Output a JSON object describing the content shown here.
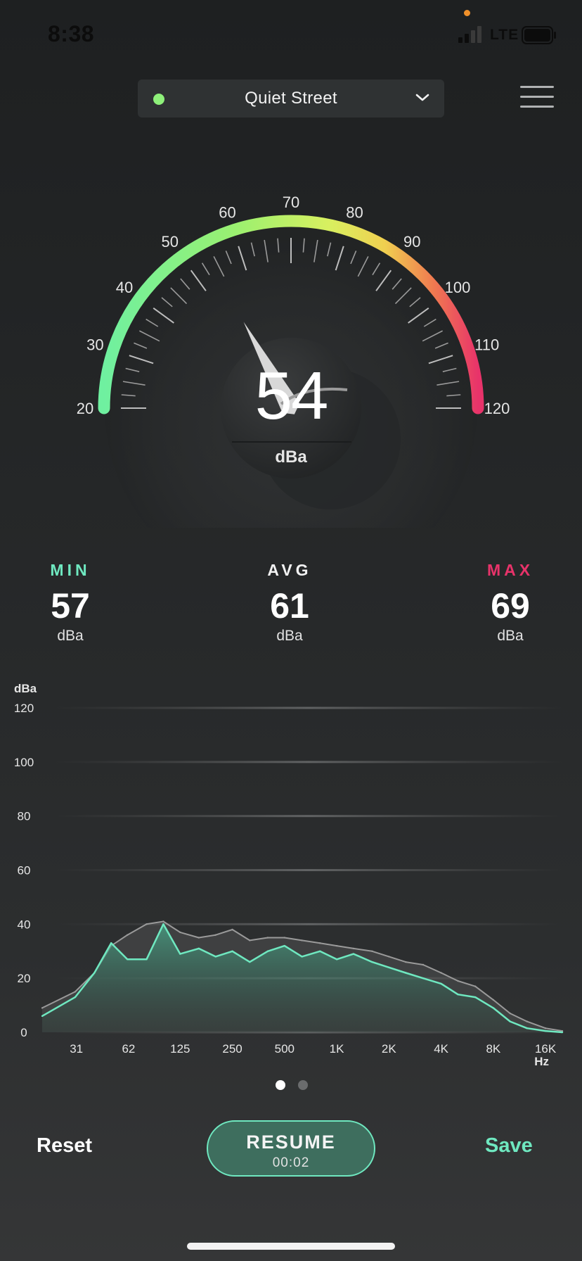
{
  "status_bar": {
    "time": "8:38",
    "network": "LTE"
  },
  "header": {
    "preset_label": "Quiet Street"
  },
  "gauge": {
    "value": "54",
    "unit": "dBa",
    "value_num": 54,
    "min": 20,
    "max": 120,
    "tick_labels": [
      "20",
      "30",
      "40",
      "50",
      "60",
      "70",
      "80",
      "90",
      "100",
      "110",
      "120"
    ]
  },
  "stats": {
    "min": {
      "label": "MIN",
      "value": "57",
      "unit": "dBa"
    },
    "avg": {
      "label": "AVG",
      "value": "61",
      "unit": "dBa"
    },
    "max": {
      "label": "MAX",
      "value": "69",
      "unit": "dBa"
    }
  },
  "colors": {
    "accent": "#6fe8c0",
    "min_label": "#6fe8c0",
    "max_label": "#e8336a",
    "gauge_start": "#6ff0a0",
    "gauge_mid": "#b8f060",
    "gauge_warn": "#f0e060",
    "gauge_end": "#e8336a"
  },
  "chart_data": {
    "type": "area",
    "ylabel": "dBa",
    "xlabel": "Hz",
    "ylim": [
      0,
      120
    ],
    "yticks": [
      "120",
      "100",
      "80",
      "60",
      "40",
      "20",
      "0"
    ],
    "xticks": [
      "31",
      "62",
      "125",
      "250",
      "500",
      "1K",
      "2K",
      "4K",
      "8K",
      "16K"
    ],
    "x_scale": "log",
    "series": [
      {
        "values": [
          [
            20,
            9
          ],
          [
            31,
            15
          ],
          [
            40,
            22
          ],
          [
            50,
            32
          ],
          [
            62,
            36
          ],
          [
            80,
            40
          ],
          [
            100,
            41
          ],
          [
            125,
            37
          ],
          [
            160,
            35
          ],
          [
            200,
            36
          ],
          [
            250,
            38
          ],
          [
            315,
            34
          ],
          [
            400,
            35
          ],
          [
            500,
            35
          ],
          [
            630,
            34
          ],
          [
            800,
            33
          ],
          [
            1000,
            32
          ],
          [
            1250,
            31
          ],
          [
            1600,
            30
          ],
          [
            2000,
            28
          ],
          [
            2500,
            26
          ],
          [
            3150,
            25
          ],
          [
            4000,
            22
          ],
          [
            5000,
            19
          ],
          [
            6300,
            17
          ],
          [
            8000,
            12
          ],
          [
            10000,
            7
          ],
          [
            12500,
            4
          ],
          [
            16000,
            1.5
          ],
          [
            20000,
            0.5
          ]
        ]
      },
      {
        "values": [
          [
            20,
            6
          ],
          [
            31,
            13
          ],
          [
            40,
            22
          ],
          [
            50,
            33
          ],
          [
            62,
            27
          ],
          [
            80,
            27
          ],
          [
            100,
            40
          ],
          [
            125,
            29
          ],
          [
            160,
            31
          ],
          [
            200,
            28
          ],
          [
            250,
            30
          ],
          [
            315,
            26
          ],
          [
            400,
            30
          ],
          [
            500,
            32
          ],
          [
            630,
            28
          ],
          [
            800,
            30
          ],
          [
            1000,
            27
          ],
          [
            1250,
            29
          ],
          [
            1600,
            26
          ],
          [
            2000,
            24
          ],
          [
            2500,
            22
          ],
          [
            3150,
            20
          ],
          [
            4000,
            18
          ],
          [
            5000,
            14
          ],
          [
            6300,
            13
          ],
          [
            8000,
            9
          ],
          [
            10000,
            4
          ],
          [
            12500,
            1.5
          ],
          [
            16000,
            0.5
          ],
          [
            20000,
            0
          ]
        ]
      }
    ]
  },
  "pager": {
    "pages": 2,
    "active": 1
  },
  "controls": {
    "reset_label": "Reset",
    "resume_label": "RESUME",
    "resume_time": "00:02",
    "save_label": "Save"
  }
}
